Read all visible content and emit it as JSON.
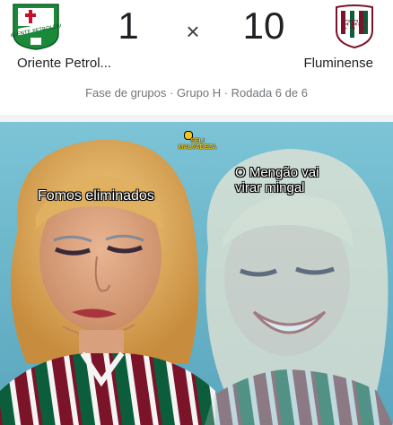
{
  "match": {
    "home_team": "Oriente Petrol...",
    "away_team": "Fluminense",
    "home_score": "1",
    "separator": "×",
    "away_score": "10",
    "stage": "Fase de grupos · Grupo H · Rodada 6 de 6",
    "home_logo_icon": "oriente-petrolero-crest-icon",
    "away_logo_icon": "fluminense-crest-icon"
  },
  "meme": {
    "left_caption": "Fomos eliminados",
    "right_caption_line1": "O Mengão vai",
    "right_caption_line2": "virar mingal",
    "watermark_line1": "SELI",
    "watermark_line2": "MALVADEZA"
  },
  "colors": {
    "fluminense_green": "#0b5d3b",
    "fluminense_maroon": "#7b1429",
    "oriente_green": "#1a8a3a",
    "sky": "#6fb7c9"
  }
}
